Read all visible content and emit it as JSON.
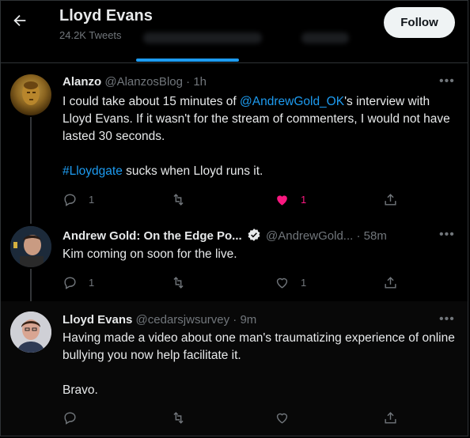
{
  "header": {
    "name": "Lloyd Evans",
    "tweet_count": "24.2K Tweets",
    "follow_label": "Follow"
  },
  "tweets": [
    {
      "name": "Alanzo",
      "handle": "@AlanzosBlog",
      "time": "1h",
      "text_part1": "I could take about 15 minutes of ",
      "mention": "@AndrewGold_OK",
      "text_part2": "'s interview with Lloyd Evans. If it wasn't for the stream of commenters, I would not have lasted 30 seconds.",
      "hashtag": "#Lloydgate",
      "text_part3": " sucks when Lloyd runs it.",
      "replies": "1",
      "likes": "1",
      "liked": true
    },
    {
      "name": "Andrew Gold: On the Edge Po...",
      "handle": "@AndrewGold...",
      "time": "58m",
      "verified": true,
      "text": "Kim coming on soon for the live.",
      "replies": "1",
      "likes": "1"
    },
    {
      "name": "Lloyd Evans",
      "handle": "@cedarsjwsurvey",
      "time": "9m",
      "text_line1": "Having made a video about one man's traumatizing experience of online bullying you now help facilitate it.",
      "text_line2": "Bravo."
    }
  ],
  "colors": {
    "background": "#000000",
    "link": "#1d9bf0",
    "muted": "#71767b",
    "like": "#f91880"
  }
}
